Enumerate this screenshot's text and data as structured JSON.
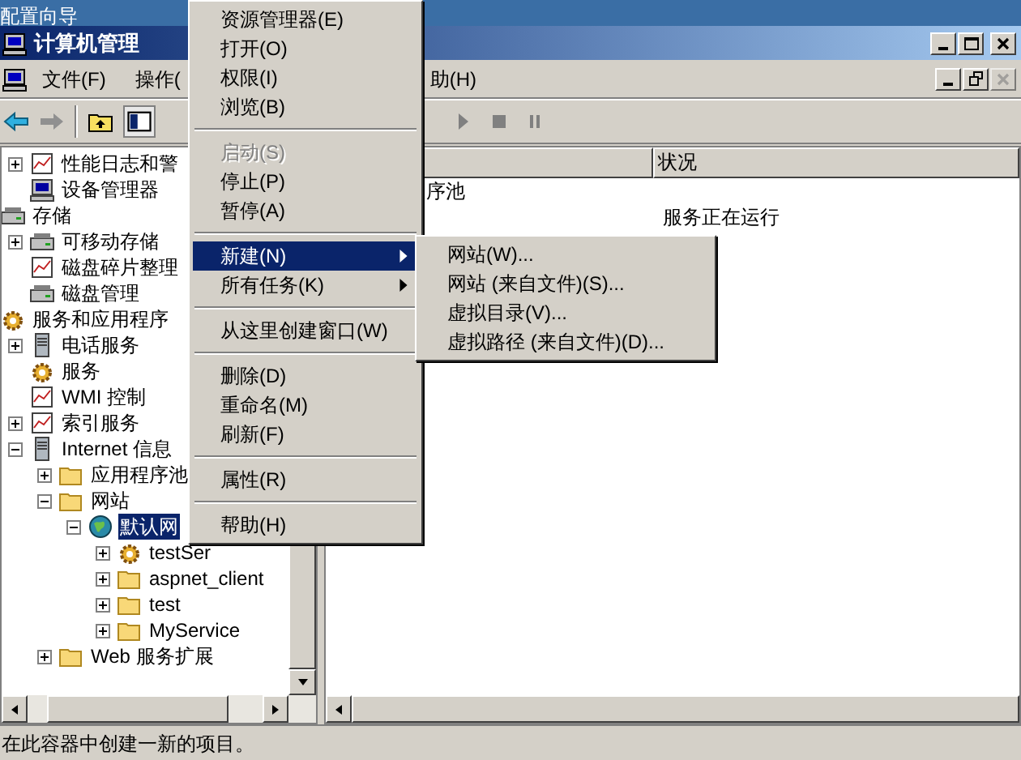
{
  "desktop": {
    "label": "配置向导"
  },
  "window": {
    "title": "计算机管理"
  },
  "menubar": [
    {
      "label": "文件(F)"
    },
    {
      "label": "操作("
    },
    {
      "label": "助(H)"
    }
  ],
  "tree": [
    {
      "children": [
        {
          "label": "性能日志和警",
          "kind": "chart",
          "expanded": false
        },
        {
          "label": "设备管理器",
          "kind": "computer"
        }
      ]
    },
    {
      "label": "存储",
      "kind": "drive",
      "children": [
        {
          "label": "可移动存储",
          "kind": "drive",
          "expanded": false
        },
        {
          "label": "磁盘碎片整理",
          "kind": "chart"
        },
        {
          "label": "磁盘管理",
          "kind": "drive"
        }
      ]
    },
    {
      "label": "服务和应用程序",
      "kind": "gear",
      "children": [
        {
          "label": "电话服务",
          "kind": "server",
          "expanded": false
        },
        {
          "label": "服务",
          "kind": "gear"
        },
        {
          "label": "WMI 控制",
          "kind": "chart"
        },
        {
          "label": "索引服务",
          "kind": "chart",
          "expanded": false
        },
        {
          "label": "Internet 信息",
          "kind": "server",
          "expanded": true,
          "children": [
            {
              "label": "应用程序池",
              "kind": "folder",
              "expanded": false
            },
            {
              "label": "网站",
              "kind": "folder",
              "expanded": true,
              "children": [
                {
                  "label": "默认网",
                  "kind": "globe",
                  "expanded": true,
                  "selected": true,
                  "children": [
                    {
                      "label": "testSer",
                      "kind": "gear",
                      "expanded": false
                    },
                    {
                      "label": "aspnet_client",
                      "kind": "folder",
                      "expanded": false
                    },
                    {
                      "label": "test",
                      "kind": "folder",
                      "expanded": false
                    },
                    {
                      "label": "MyService",
                      "kind": "folder",
                      "expanded": false
                    }
                  ]
                }
              ]
            },
            {
              "label": "Web 服务扩展",
              "kind": "folder",
              "expanded": false
            }
          ]
        }
      ]
    }
  ],
  "list": {
    "columns": [
      "状况"
    ],
    "rows": [
      {
        "name": "序池"
      },
      {
        "status": "服务正在运行"
      }
    ]
  },
  "context_menu": [
    {
      "kind": "item",
      "label": "资源管理器(E)"
    },
    {
      "kind": "item",
      "label": "打开(O)"
    },
    {
      "kind": "item",
      "label": "权限(I)"
    },
    {
      "kind": "item",
      "label": "浏览(B)"
    },
    {
      "kind": "separator"
    },
    {
      "kind": "item",
      "label": "启动(S)",
      "disabled": true
    },
    {
      "kind": "item",
      "label": "停止(P)"
    },
    {
      "kind": "item",
      "label": "暂停(A)"
    },
    {
      "kind": "separator"
    },
    {
      "kind": "item",
      "label": "新建(N)",
      "submenu": true,
      "selected": true
    },
    {
      "kind": "item",
      "label": "所有任务(K)",
      "submenu": true,
      "selected": false
    },
    {
      "kind": "separator"
    },
    {
      "kind": "item",
      "label": "从这里创建窗口(W)"
    },
    {
      "kind": "separator"
    },
    {
      "kind": "item",
      "label": "删除(D)"
    },
    {
      "kind": "item",
      "label": "重命名(M)"
    },
    {
      "kind": "item",
      "label": "刷新(F)"
    },
    {
      "kind": "separator"
    },
    {
      "kind": "item",
      "label": "属性(R)"
    },
    {
      "kind": "separator"
    },
    {
      "kind": "item",
      "label": "帮助(H)"
    }
  ],
  "submenu": [
    {
      "label": "网站(W)..."
    },
    {
      "label": "网站 (来自文件)(S)..."
    },
    {
      "label": "虚拟目录(V)..."
    },
    {
      "label": "虚拟路径 (来自文件)(D)..."
    }
  ],
  "status_bar": "在此容器中创建一新的项目。"
}
